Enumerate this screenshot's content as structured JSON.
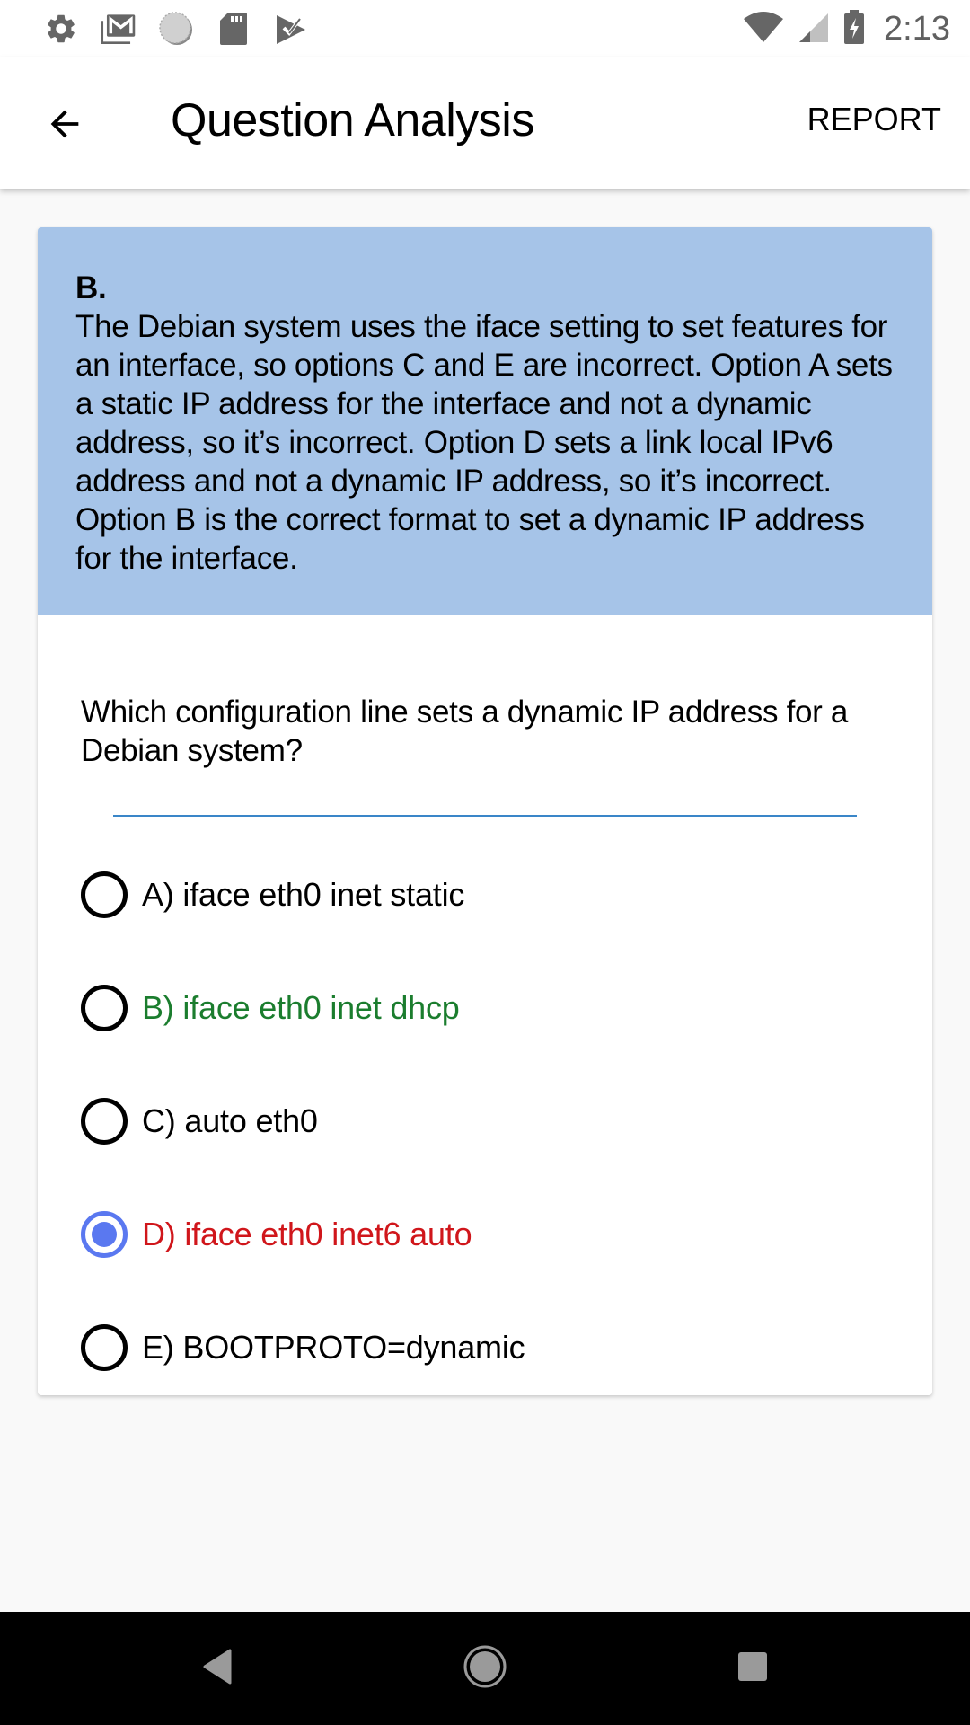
{
  "status_bar": {
    "left_icons": [
      "settings-icon",
      "gmail-icon",
      "sync-icon",
      "sd-card-icon",
      "tasks-check-icon"
    ],
    "right_icons": [
      "wifi-icon",
      "cell-signal-icon",
      "battery-charging-icon"
    ],
    "time": "2:13"
  },
  "app_bar": {
    "back_icon": "arrow-back-icon",
    "title": "Question Analysis",
    "report_label": "REPORT"
  },
  "explanation": {
    "answer": "B.",
    "text": "The Debian system uses the iface setting to set features for an interface, so options C and E are incorrect. Option A sets a static IP address for the interface and not a dynamic address, so it’s incorrect. Option D sets a link local IPv6 address and not a dynamic IP address, so it’s incorrect. Option B is the correct format to set a dynamic IP address for the interface.",
    "background_color": "#a6c4e8"
  },
  "question": {
    "text": "Which configuration line sets a dynamic IP address for a Debian system?"
  },
  "options": [
    {
      "label": "A) iface eth0 inet static",
      "selected": false,
      "state": "normal"
    },
    {
      "label": "B) iface eth0 inet dhcp",
      "selected": false,
      "state": "correct"
    },
    {
      "label": "C) auto eth0",
      "selected": false,
      "state": "normal"
    },
    {
      "label": "D) iface eth0 inet6 auto",
      "selected": true,
      "state": "wrong"
    },
    {
      "label": "E) BOOTPROTO=dynamic",
      "selected": false,
      "state": "normal"
    }
  ],
  "colors": {
    "correct": "#1b7d2e",
    "wrong": "#d0161b",
    "radio_selected": "#5a78f0",
    "divider": "#3a86c8"
  },
  "nav_bar": {
    "icons": [
      "nav-back-icon",
      "nav-home-icon",
      "nav-recents-icon"
    ]
  }
}
